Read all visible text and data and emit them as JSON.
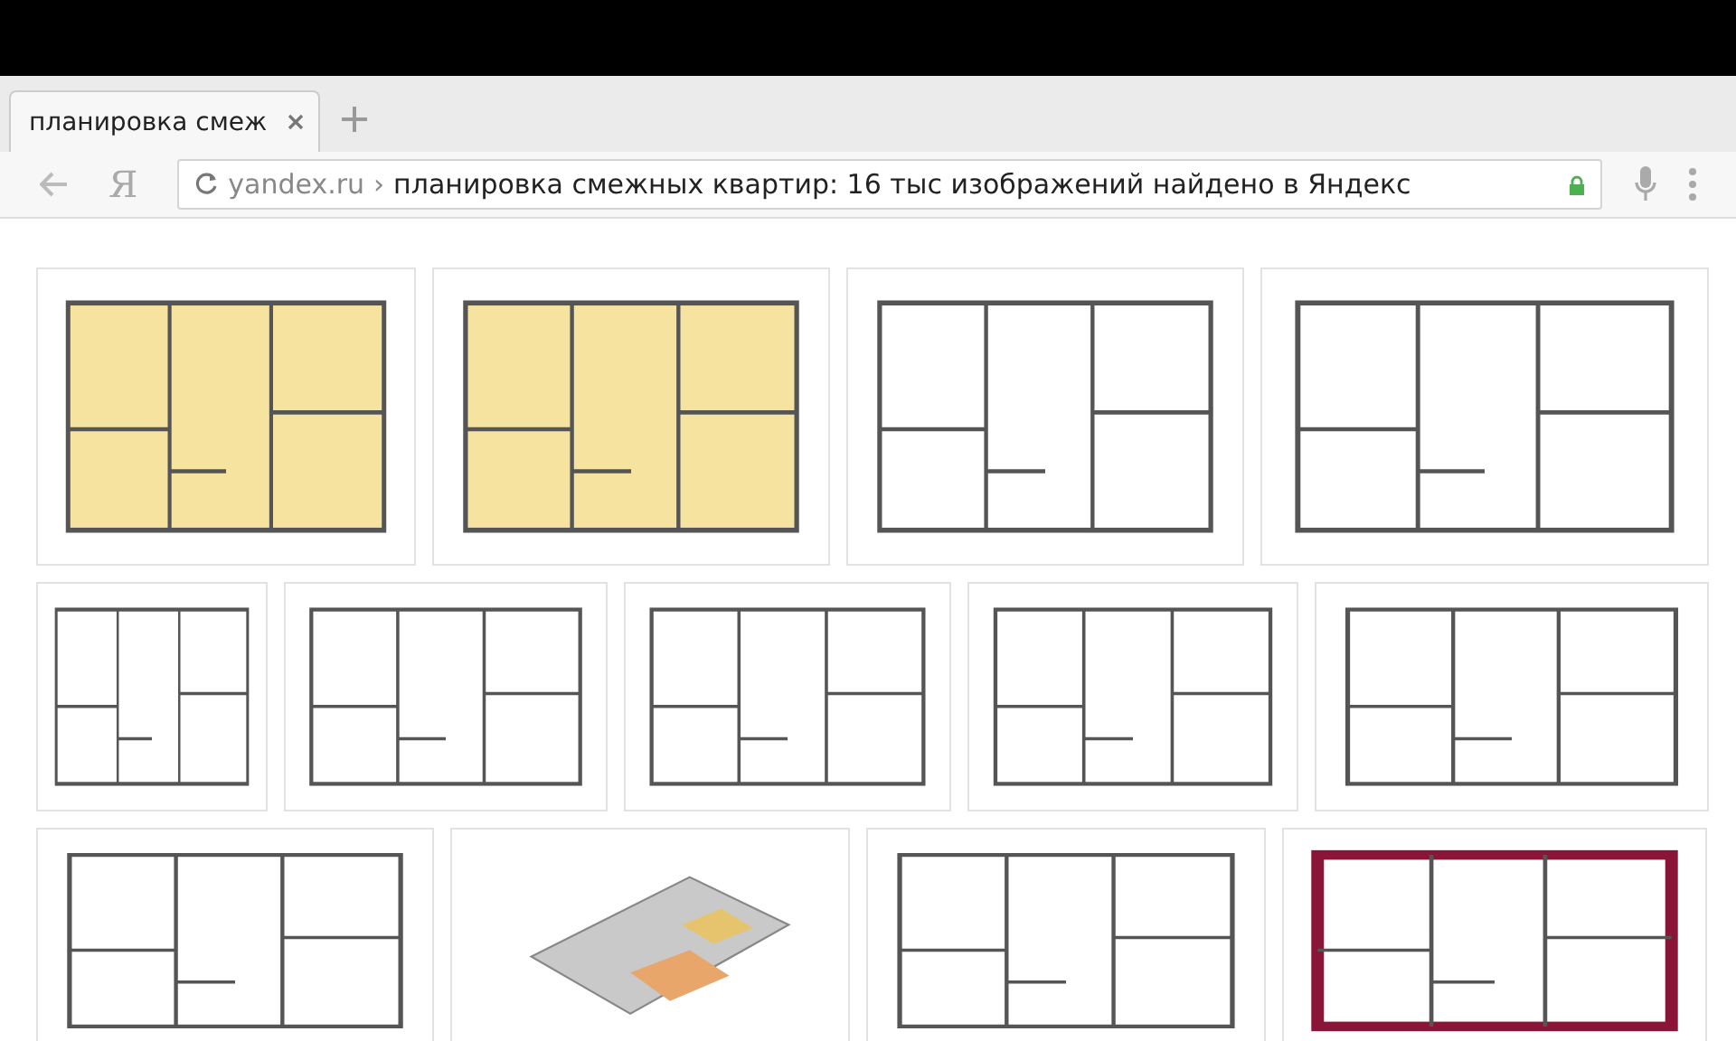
{
  "tab": {
    "title": "планировка смеж",
    "selected": true
  },
  "toolbar": {
    "logo": "Я",
    "domain": "yandex.ru",
    "separator": "›",
    "page_title": "планировка смежных квартир: 16 тыс изображений найдено в Яндекс"
  },
  "image_rows": [
    {
      "images": [
        {
          "kind": "color"
        },
        {
          "kind": "color"
        },
        {
          "kind": "line"
        },
        {
          "kind": "line"
        }
      ]
    },
    {
      "images": [
        {
          "kind": "line"
        },
        {
          "kind": "line"
        },
        {
          "kind": "line"
        },
        {
          "kind": "line"
        },
        {
          "kind": "line"
        }
      ]
    },
    {
      "images": [
        {
          "kind": "line"
        },
        {
          "kind": "model"
        },
        {
          "kind": "line"
        },
        {
          "kind": "accent"
        }
      ]
    }
  ]
}
